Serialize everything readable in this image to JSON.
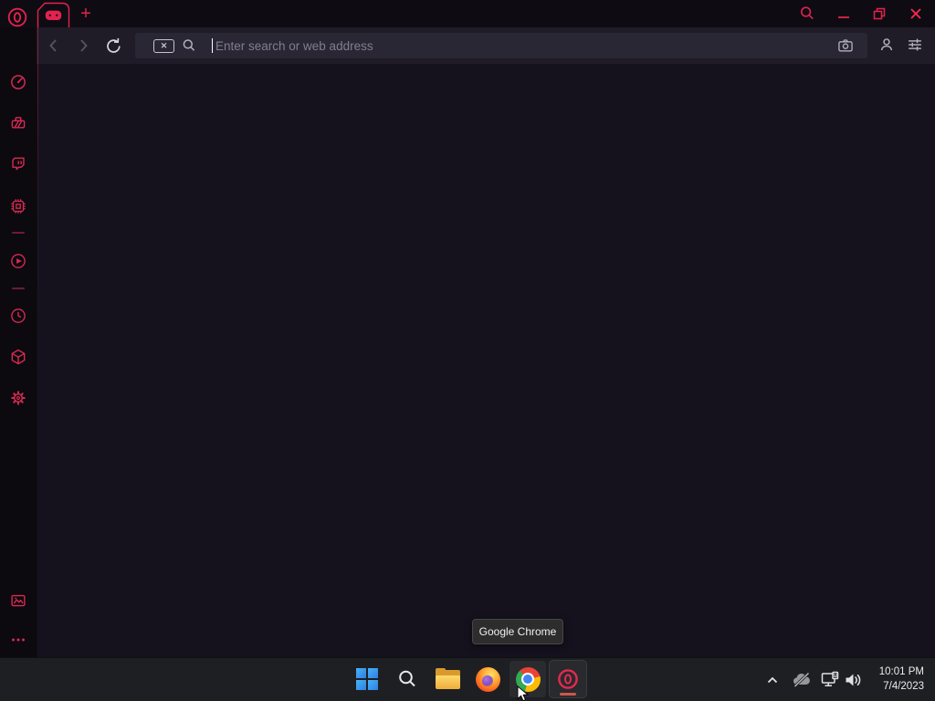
{
  "browser": {
    "name": "Opera GX",
    "tab_strip": {
      "logo_icon": "opera-gx-logo",
      "active_tab": {
        "icon": "gamepad-icon"
      },
      "new_tab_button": "+",
      "window_controls": {
        "search": "search-icon",
        "minimize": "minimize-icon",
        "maximize": "restore-icon",
        "close": "close-icon"
      }
    },
    "toolbar": {
      "back_icon": "chevron-left-icon",
      "forward_icon": "chevron-right-icon",
      "reload_icon": "reload-icon",
      "address_bar": {
        "badge_glyph": "✕",
        "badge_icon": "speed-dial-badge-icon",
        "search_icon": "search-icon",
        "placeholder": "Enter search or web address",
        "camera_icon": "camera-icon"
      },
      "profile_icon": "person-icon",
      "easy_setup_icon": "sliders-icon"
    },
    "sidebar": {
      "items": [
        {
          "name": "speed-dial",
          "icon": "speedometer-icon"
        },
        {
          "name": "gx-cleaner",
          "icon": "dustpan-icon"
        },
        {
          "name": "twitch",
          "icon": "twitch-icon"
        },
        {
          "name": "gx-control",
          "icon": "cpu-chip-icon"
        },
        {
          "name": "player",
          "icon": "play-circle-icon"
        },
        {
          "name": "history",
          "icon": "clock-icon"
        },
        {
          "name": "extensions",
          "icon": "cube-icon"
        },
        {
          "name": "settings",
          "icon": "gear-icon"
        },
        {
          "name": "snapshot",
          "icon": "image-icon"
        },
        {
          "name": "sidebar-setup",
          "icon": "ellipsis-icon"
        }
      ]
    }
  },
  "tooltip": {
    "text": "Google Chrome"
  },
  "taskbar": {
    "apps": [
      {
        "name": "start",
        "icon": "windows-logo-icon"
      },
      {
        "name": "search",
        "icon": "search-icon"
      },
      {
        "name": "file-explorer",
        "icon": "folder-icon"
      },
      {
        "name": "firefox",
        "icon": "firefox-icon"
      },
      {
        "name": "chrome",
        "icon": "chrome-icon",
        "state": "hovered"
      },
      {
        "name": "opera-gx",
        "icon": "opera-gx-icon",
        "state": "running"
      }
    ],
    "tray": {
      "hidden_icons_icon": "chevron-up-icon",
      "onedrive_icon": "cloud-offline-icon",
      "network_icon": "ethernet-icon",
      "volume_icon": "speaker-icon",
      "time": "10:01 PM",
      "date": "7/4/2023"
    }
  },
  "colors": {
    "accent": "#e3224f",
    "close_red": "#ff2950",
    "sidebar_bg": "#0c0a0f",
    "toolbar_bg": "#1f1c28",
    "address_bar_bg": "#2a2735",
    "content_bg": "#15121e",
    "taskbar_bg": "#1e1f22",
    "tooltip_bg": "#2d2d2d",
    "running_pill": "#cb584e"
  }
}
